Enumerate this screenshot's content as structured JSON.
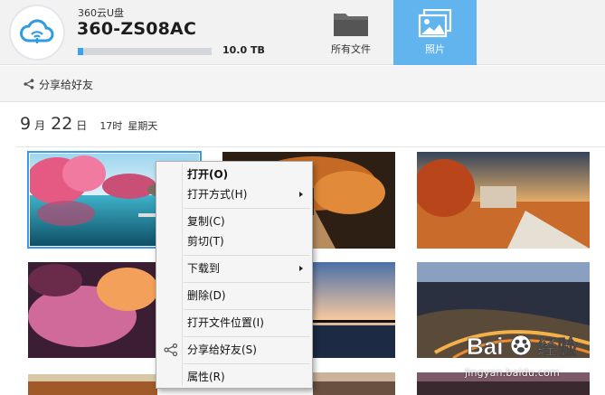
{
  "header": {
    "brand": "360云U盘",
    "device_name": "360-ZS08AC",
    "storage": {
      "total": "10.0 TB",
      "used_fraction": 0.04
    },
    "tabs": [
      {
        "label": "所有文件",
        "icon": "folder-icon",
        "active": false
      },
      {
        "label": "照片",
        "icon": "photos-icon",
        "active": true
      }
    ],
    "accent_color": "#62b4ee"
  },
  "toolbar": {
    "share_label": "分享给好友"
  },
  "date_group": {
    "month": "9",
    "month_unit": "月",
    "day": "22",
    "day_unit": "日",
    "time": "17时",
    "weekday": "星期天"
  },
  "photos": [
    {
      "name": "pink-trees-lake",
      "selected": true
    },
    {
      "name": "autumn-tree-path",
      "selected": false
    },
    {
      "name": "autumn-house",
      "selected": false
    },
    {
      "name": "pink-blossom",
      "selected": false
    },
    {
      "name": "sunset-lake",
      "selected": false
    },
    {
      "name": "city-night-aerial",
      "selected": false
    },
    {
      "name": "bottom-left",
      "selected": false
    },
    {
      "name": "bottom-middle",
      "selected": false
    },
    {
      "name": "bottom-right",
      "selected": false
    }
  ],
  "context_menu": {
    "items": [
      {
        "label": "打开(O)",
        "bold": true,
        "submenu": false
      },
      {
        "label": "打开方式(H)",
        "bold": false,
        "submenu": true
      },
      {
        "label": "复制(C)",
        "bold": false,
        "submenu": false
      },
      {
        "label": "剪切(T)",
        "bold": false,
        "submenu": false
      },
      {
        "label": "下载到",
        "bold": false,
        "submenu": true
      },
      {
        "label": "删除(D)",
        "bold": false,
        "submenu": false
      },
      {
        "label": "打开文件位置(I)",
        "bold": false,
        "submenu": false
      },
      {
        "label": "分享给好友(S)",
        "bold": false,
        "submenu": false,
        "icon": "share-icon"
      },
      {
        "label": "属性(R)",
        "bold": false,
        "submenu": false
      }
    ]
  },
  "watermark": {
    "logo": "Bai 经验",
    "url": "jingyan.baidu.com"
  }
}
